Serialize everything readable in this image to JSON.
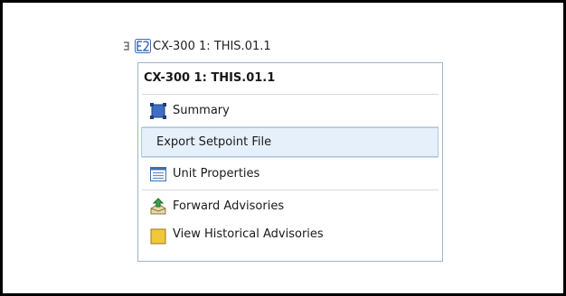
{
  "tree_node": {
    "label": "CX-300 1: THIS.01.1",
    "icon": "device-e2-icon"
  },
  "context_menu": {
    "title": "CX-300 1: THIS.01.1",
    "items": [
      {
        "label": "Summary",
        "icon": "summary-icon"
      },
      {
        "label": "Export Setpoint File",
        "icon": ""
      },
      {
        "label": "Unit Properties",
        "icon": "properties-list-icon"
      },
      {
        "label": "Forward Advisories",
        "icon": "forward-advisories-icon"
      },
      {
        "label": "View Historical Advisories",
        "icon": "advisories-icon"
      }
    ]
  },
  "colors": {
    "highlight_bg": "#e6f0fb",
    "highlight_border": "#a9c7ea",
    "menu_border": "#9fb3c8"
  }
}
